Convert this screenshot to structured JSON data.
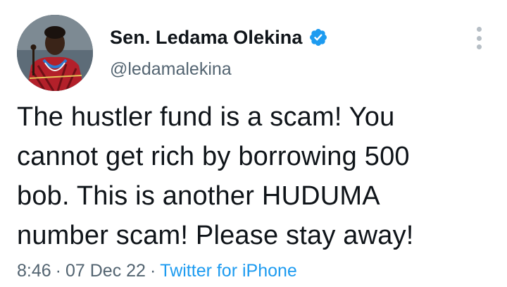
{
  "author": {
    "display_name": "Sen. Ledama Olekina",
    "handle": "@ledamalekina",
    "verified_icon": "verified-badge-icon",
    "avatar_icon": "profile-avatar"
  },
  "tweet": {
    "lines": [
      "The hustler fund is a scam! You",
      "cannot get rich by borrowing 500",
      "bob. This is another HUDUMA",
      "number scam! Please stay away!"
    ],
    "time": "8:46",
    "date": "07 Dec 22",
    "separator": "·",
    "source": "Twitter for iPhone"
  },
  "menu": {
    "icon": "more-options-icon"
  },
  "colors": {
    "text": "#0f1419",
    "secondary": "#536471",
    "link": "#1d9bf0",
    "verified": "#1d9bf0"
  }
}
